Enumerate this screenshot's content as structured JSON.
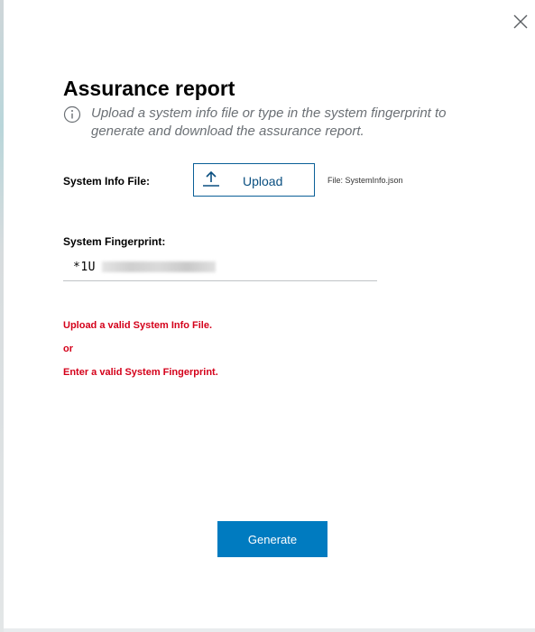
{
  "dialog": {
    "title": "Assurance report",
    "info_text": "Upload a system info file or type in the system fingerprint to generate and download the assurance report."
  },
  "icons": {
    "close": "close-icon",
    "info": "info-icon",
    "upload": "upload-icon"
  },
  "system_info": {
    "label": "System Info File:",
    "upload_label": "Upload",
    "file_name": "File: SystemInfo.json"
  },
  "fingerprint": {
    "label": "System Fingerprint:",
    "value": "*1U"
  },
  "errors": {
    "line1": "Upload a valid System Info File.",
    "line2": "or",
    "line3": "Enter a valid System Fingerprint."
  },
  "actions": {
    "generate_label": "Generate"
  },
  "colors": {
    "primary": "#007bc0",
    "outline": "#0a5f97",
    "error": "#d4001a",
    "muted_text": "#6b7075"
  }
}
